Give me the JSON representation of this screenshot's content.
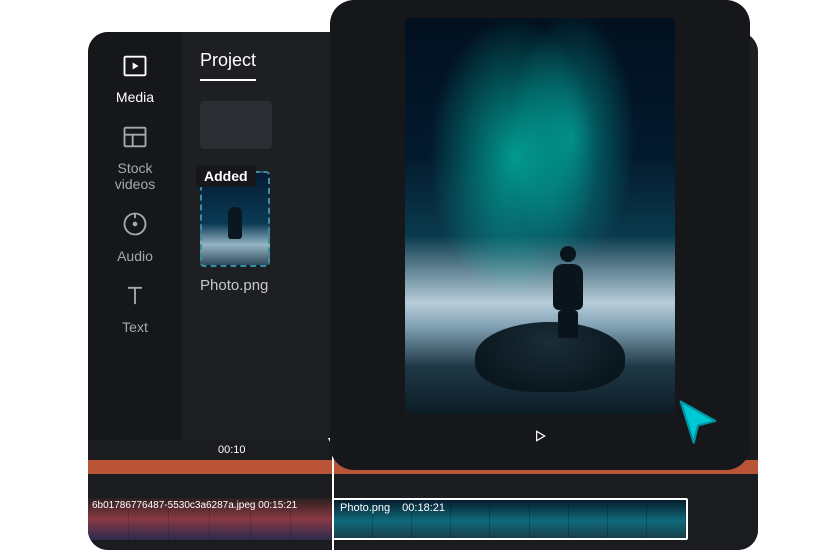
{
  "sidebar": {
    "items": [
      {
        "label": "Media"
      },
      {
        "label": "Stock\nvideos"
      },
      {
        "label": "Audio"
      },
      {
        "label": "Text"
      }
    ]
  },
  "panel": {
    "tab": "Project",
    "badge": "Added",
    "thumb_name": "Photo.png"
  },
  "timeline": {
    "ruler": [
      "00:10"
    ],
    "clip_a_label": "6b01786776487-5530c3a6287a.jpeg   00:15:21",
    "clip_b": {
      "name": "Photo.png",
      "time": "00:18:21"
    }
  },
  "preview": {
    "play_label": "Play"
  },
  "colors": {
    "accent": "#00c9d6"
  }
}
